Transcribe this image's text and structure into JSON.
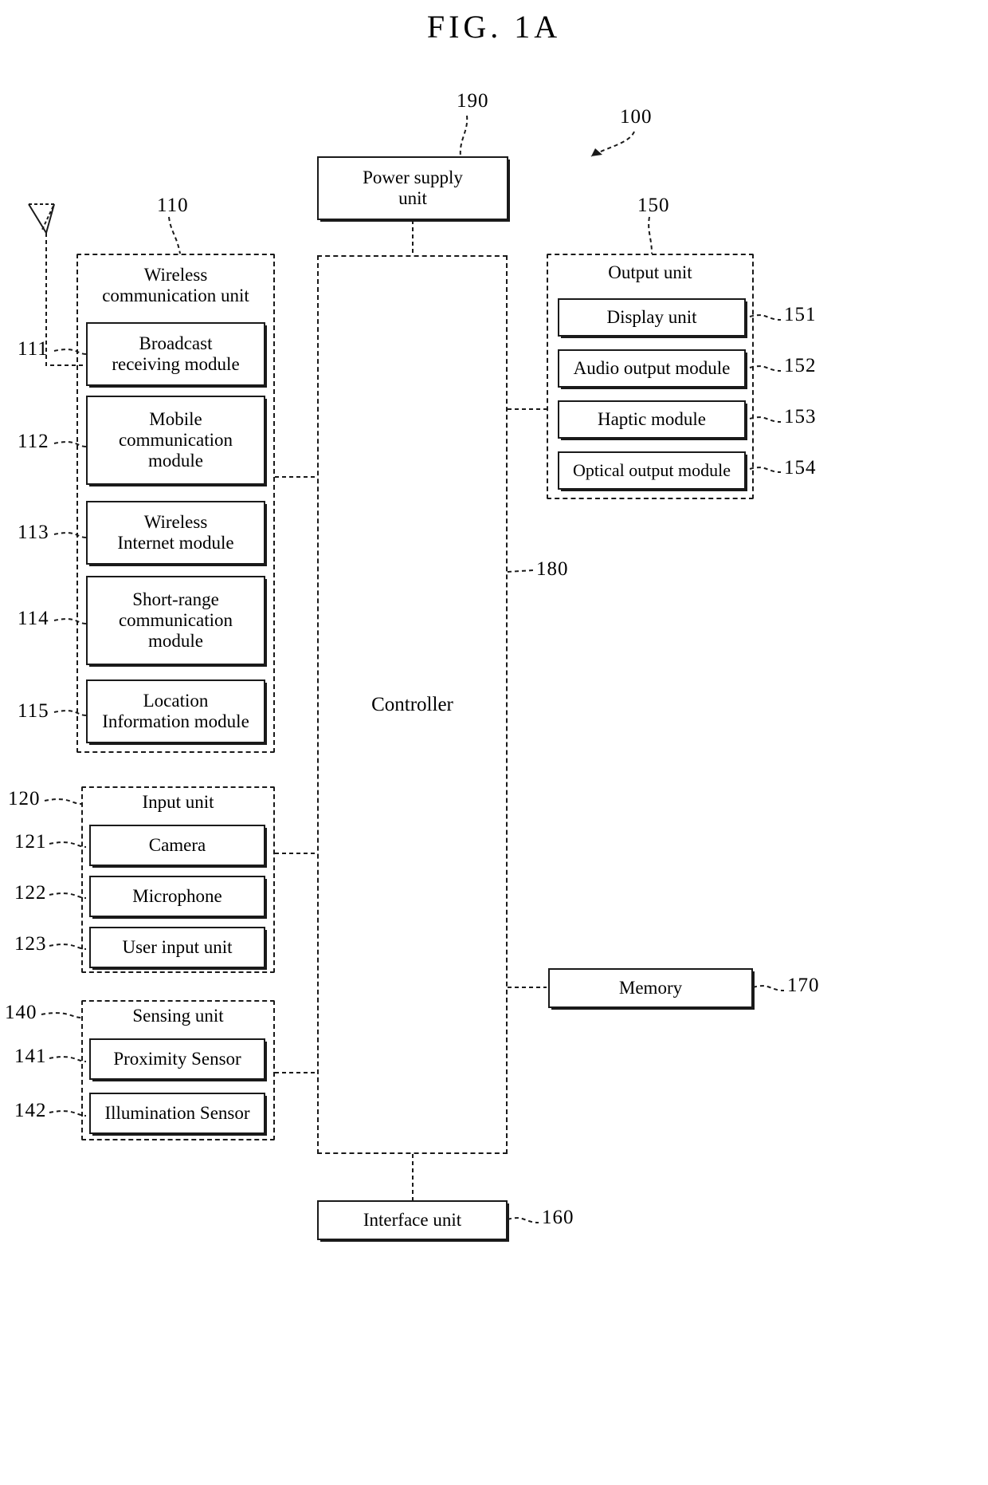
{
  "figure": {
    "title": "FIG. 1A",
    "overall_ref": "100"
  },
  "power_supply": {
    "label": "Power supply\nunit",
    "label_line1": "Power supply",
    "label_line2": "unit",
    "ref": "190"
  },
  "controller": {
    "label": "Controller",
    "ref": "180"
  },
  "wireless_communication_unit": {
    "title_line1": "Wireless",
    "title_line2": "communication unit",
    "ref": "110",
    "modules": [
      {
        "ref": "111",
        "line1": "Broadcast",
        "line2": "receiving module",
        "line3": ""
      },
      {
        "ref": "112",
        "line1": "Mobile",
        "line2": "communication",
        "line3": "module"
      },
      {
        "ref": "113",
        "line1": "Wireless",
        "line2": "Internet module",
        "line3": ""
      },
      {
        "ref": "114",
        "line1": "Short-range",
        "line2": "communication",
        "line3": "module"
      },
      {
        "ref": "115",
        "line1": "Location",
        "line2": "Information module",
        "line3": ""
      }
    ]
  },
  "input_unit": {
    "title": "Input unit",
    "ref": "120",
    "modules": [
      {
        "ref": "121",
        "label": "Camera"
      },
      {
        "ref": "122",
        "label": "Microphone"
      },
      {
        "ref": "123",
        "label": "User input unit"
      }
    ]
  },
  "sensing_unit": {
    "title": "Sensing unit",
    "ref": "140",
    "modules": [
      {
        "ref": "141",
        "label": "Proximity Sensor"
      },
      {
        "ref": "142",
        "label": "Illumination Sensor"
      }
    ]
  },
  "output_unit": {
    "title": "Output unit",
    "ref": "150",
    "modules": [
      {
        "ref": "151",
        "label": "Display unit"
      },
      {
        "ref": "152",
        "label": "Audio output module"
      },
      {
        "ref": "153",
        "label": "Haptic module"
      },
      {
        "ref": "154",
        "label": "Optical output module"
      }
    ]
  },
  "memory": {
    "label": "Memory",
    "ref": "170"
  },
  "interface_unit": {
    "label": "Interface unit",
    "ref": "160"
  },
  "icons": {
    "antenna": "antenna-icon"
  },
  "colors": {
    "line": "#1a1a1a",
    "background": "#ffffff"
  }
}
